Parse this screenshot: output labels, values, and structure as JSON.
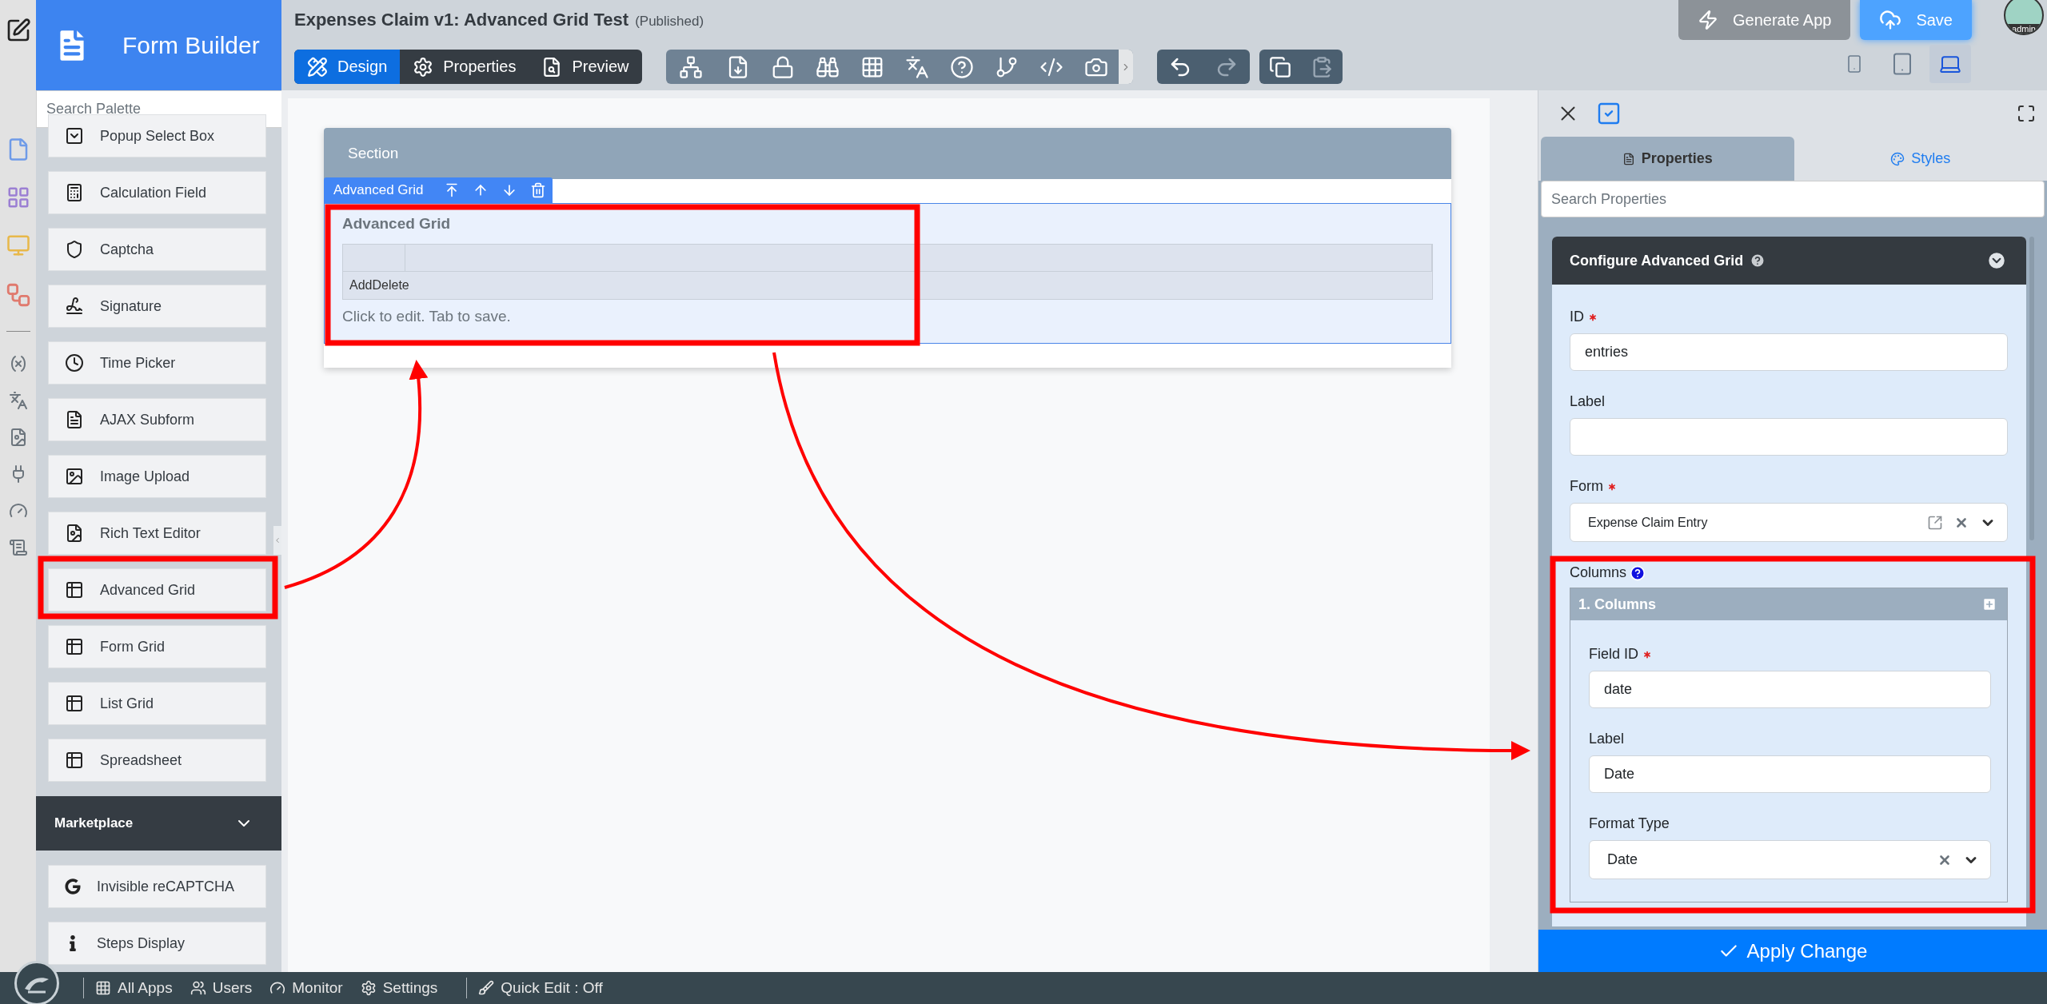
{
  "palette": {
    "title": "Form Builder",
    "search_placeholder": "Search Palette",
    "items": [
      "Popup Select Box",
      "Calculation Field",
      "Captcha",
      "Signature",
      "Time Picker",
      "AJAX Subform",
      "Image Upload",
      "Rich Text Editor",
      "Advanced Grid",
      "Form Grid",
      "List Grid",
      "Spreadsheet"
    ],
    "marketplace": {
      "title": "Marketplace",
      "items": [
        "Invisible reCAPTCHA",
        "Steps Display"
      ]
    }
  },
  "form": {
    "title": "Expenses Claim v1: Advanced Grid Test",
    "status": "(Published)"
  },
  "mode_tabs": [
    {
      "label": "Design",
      "selected": true
    },
    {
      "label": "Properties",
      "selected": false
    },
    {
      "label": "Preview",
      "selected": false
    }
  ],
  "header_buttons": {
    "generate": "Generate App",
    "save": "Save"
  },
  "avatar_label": "admin",
  "device_views": [
    {
      "selected": false
    },
    {
      "selected": false
    },
    {
      "selected": true
    }
  ],
  "canvas": {
    "section_title": "Section",
    "element_toolbar_label": "Advanced Grid",
    "grid_label": "Advanced Grid",
    "grid_actions": "AddDelete",
    "hint": "Click to edit. Tab to save."
  },
  "properties_panel": {
    "tabs": [
      {
        "label": "Properties",
        "selected": true
      },
      {
        "label": "Styles",
        "selected": false
      }
    ],
    "search_placeholder": "Search Properties",
    "card_title": "Configure Advanced Grid",
    "fields": [
      {
        "label": "ID",
        "required": true,
        "kind": "text",
        "value": "entries"
      },
      {
        "label": "Label",
        "required": false,
        "kind": "text"
      },
      {
        "label": "Form",
        "required": true,
        "kind": "select",
        "value": "Expense Claim Entry",
        "link": true
      }
    ],
    "columns": {
      "label": "Columns",
      "group_title": "1. Columns",
      "fields": [
        {
          "label": "Field ID",
          "required": true,
          "kind": "text",
          "value": "date"
        },
        {
          "label": "Label",
          "required": false,
          "kind": "text",
          "value": "Date"
        },
        {
          "label": "Format Type",
          "required": false,
          "kind": "select",
          "value": "Date",
          "link": false
        }
      ]
    },
    "apply_button": "Apply Change"
  },
  "bottom_bar": {
    "items": [
      "All Apps",
      "Users",
      "Monitor",
      "Settings"
    ],
    "quick_edit": "Quick Edit : Off"
  }
}
